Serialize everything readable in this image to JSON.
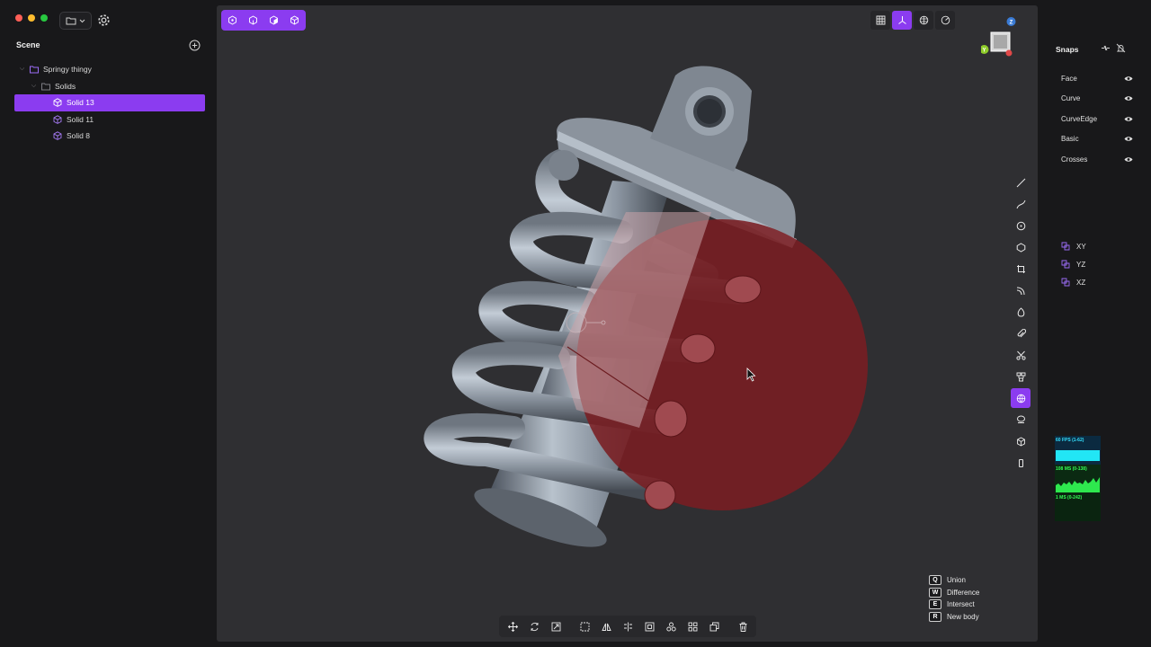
{
  "window": {
    "traffic_colors": [
      "#ff5f57",
      "#febc2e",
      "#28c840"
    ]
  },
  "sidebar": {
    "title": "Scene",
    "items": [
      {
        "label": "Springy thingy",
        "type": "folder",
        "indent": 0,
        "expanded": true,
        "selected": false
      },
      {
        "label": "Solids",
        "type": "folder",
        "indent": 1,
        "expanded": true,
        "selected": false
      },
      {
        "label": "Solid 13",
        "type": "solid",
        "indent": 2,
        "selected": true
      },
      {
        "label": "Solid 11",
        "type": "solid",
        "indent": 2,
        "selected": false
      },
      {
        "label": "Solid 8",
        "type": "solid",
        "indent": 2,
        "selected": false
      }
    ]
  },
  "viewport": {
    "top_toolbar_icons": [
      "vertex-select-icon",
      "edge-select-icon",
      "face-select-icon",
      "solid-select-icon"
    ],
    "view_toolbar_icons": [
      "grid-icon",
      "axes-icon",
      "render-mode-icon",
      "camera-icon"
    ],
    "view_active": "axes-icon",
    "right_toolbar_icons": [
      "line-icon",
      "curve-icon",
      "circle-icon",
      "polygon-icon",
      "rectangle-icon",
      "spline-icon",
      "sphere-icon",
      "attach-icon",
      "cut-icon",
      "boolean-icon",
      "globe-icon",
      "offset-icon",
      "box-icon",
      "phone-icon"
    ],
    "right_active": "globe-icon",
    "bottom_toolbar_icons": [
      "move-icon",
      "rotate-icon",
      "scale-icon",
      "frame-icon",
      "mirror-icon",
      "align-icon",
      "fit-icon",
      "group-icon",
      "grid-array-icon",
      "duplicate-icon",
      "delete-icon"
    ],
    "shortcuts": [
      {
        "key": "Q",
        "label": "Union"
      },
      {
        "key": "W",
        "label": "Difference"
      },
      {
        "key": "E",
        "label": "Intersect"
      },
      {
        "key": "R",
        "label": "New body"
      }
    ],
    "gizmo": {
      "z": "Z",
      "y": "Y"
    }
  },
  "snaps_panel": {
    "title": "Snaps",
    "snaps": [
      "Face",
      "Curve",
      "CurveEdge",
      "Basic",
      "Crosses"
    ],
    "planes": [
      "XY",
      "YZ",
      "XZ"
    ]
  },
  "performance": {
    "fps": "60 FPS (1-62)",
    "ms": "108 MS (0-138)",
    "mem": "1 MS (0-242)"
  },
  "colors": {
    "accent": "#8b3cf0",
    "viewport_bg": "#2f2f32",
    "sphere": "#7a1e22",
    "metal": "#8e9aa6"
  }
}
